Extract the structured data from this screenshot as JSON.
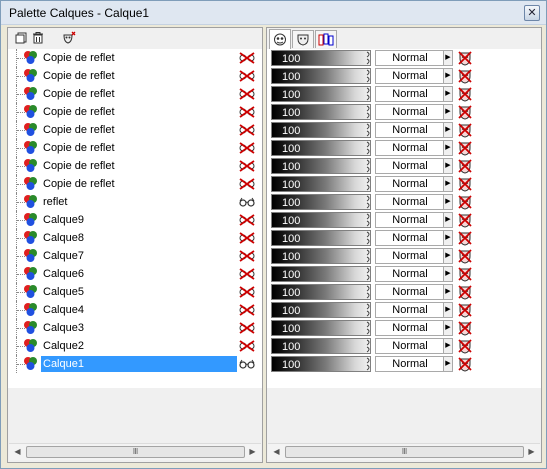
{
  "window": {
    "title": "Palette Calques - Calque1",
    "close_label": "✕"
  },
  "toolbar": {
    "buttons": [
      {
        "name": "new-layer-icon"
      },
      {
        "name": "delete-layer-icon"
      },
      {
        "name": "mask-properties-icon"
      }
    ]
  },
  "tabs": [
    {
      "name": "layer-blend-tab-icon",
      "active": true
    },
    {
      "name": "mask-tab-icon",
      "active": false
    },
    {
      "name": "channels-tab-icon",
      "active": false
    }
  ],
  "layers": [
    {
      "name": "Copie de reflet",
      "visible": false,
      "opacity": "100",
      "blend": "Normal"
    },
    {
      "name": "Copie de reflet",
      "visible": false,
      "opacity": "100",
      "blend": "Normal"
    },
    {
      "name": "Copie de reflet",
      "visible": false,
      "opacity": "100",
      "blend": "Normal"
    },
    {
      "name": "Copie de reflet",
      "visible": false,
      "opacity": "100",
      "blend": "Normal"
    },
    {
      "name": "Copie de reflet",
      "visible": false,
      "opacity": "100",
      "blend": "Normal"
    },
    {
      "name": "Copie de reflet",
      "visible": false,
      "opacity": "100",
      "blend": "Normal"
    },
    {
      "name": "Copie de reflet",
      "visible": false,
      "opacity": "100",
      "blend": "Normal"
    },
    {
      "name": "Copie de reflet",
      "visible": false,
      "opacity": "100",
      "blend": "Normal"
    },
    {
      "name": "reflet",
      "visible": true,
      "opacity": "100",
      "blend": "Normal"
    },
    {
      "name": "Calque9",
      "visible": false,
      "opacity": "100",
      "blend": "Normal"
    },
    {
      "name": "Calque8",
      "visible": false,
      "opacity": "100",
      "blend": "Normal"
    },
    {
      "name": "Calque7",
      "visible": false,
      "opacity": "100",
      "blend": "Normal"
    },
    {
      "name": "Calque6",
      "visible": false,
      "opacity": "100",
      "blend": "Normal"
    },
    {
      "name": "Calque5",
      "visible": false,
      "opacity": "100",
      "blend": "Normal"
    },
    {
      "name": "Calque4",
      "visible": false,
      "opacity": "100",
      "blend": "Normal"
    },
    {
      "name": "Calque3",
      "visible": false,
      "opacity": "100",
      "blend": "Normal"
    },
    {
      "name": "Calque2",
      "visible": false,
      "opacity": "100",
      "blend": "Normal"
    },
    {
      "name": "Calque1",
      "visible": true,
      "opacity": "100",
      "blend": "Normal",
      "selected": true
    }
  ],
  "scrollbars": {
    "left_thumb": "Ⅲ",
    "right_thumb": "Ⅲ",
    "left_arrow": "◀",
    "right_arrow": "▶"
  },
  "colors": {
    "selection": "#3399ff",
    "hidden_icon": "#cc0000",
    "mask_icon": "#cc0000"
  }
}
